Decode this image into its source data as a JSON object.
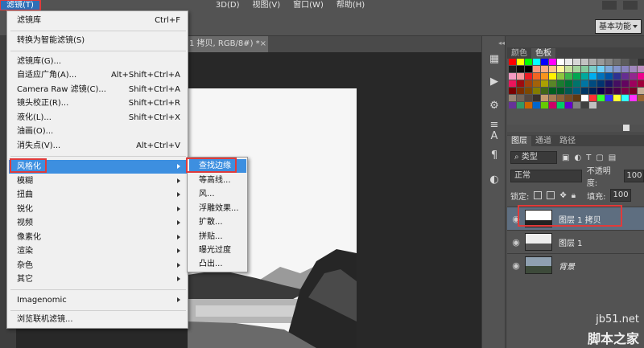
{
  "menubar": {
    "items": [
      "滤镜(T)",
      "3D(D)",
      "视图(V)",
      "窗口(W)",
      "帮助(H)"
    ]
  },
  "optbar": {
    "workspace": "基本功能"
  },
  "document": {
    "tab_title": "1 拷贝, RGB/8#) *",
    "tab_close": "×"
  },
  "filter_menu": {
    "items": [
      {
        "label": "滤镜库",
        "shortcut": "Ctrl+F"
      },
      {
        "label": "转换为智能滤镜(S)",
        "shortcut": ""
      },
      {
        "label": "滤镜库(G)...",
        "shortcut": ""
      },
      {
        "label": "自适应广角(A)...",
        "shortcut": "Alt+Shift+Ctrl+A"
      },
      {
        "label": "Camera Raw 滤镜(C)...",
        "shortcut": "Shift+Ctrl+A"
      },
      {
        "label": "镜头校正(R)...",
        "shortcut": "Shift+Ctrl+R"
      },
      {
        "label": "液化(L)...",
        "shortcut": "Shift+Ctrl+X"
      },
      {
        "label": "油画(O)...",
        "shortcut": ""
      },
      {
        "label": "消失点(V)...",
        "shortcut": "Alt+Ctrl+V"
      },
      {
        "label": "风格化",
        "shortcut": ""
      },
      {
        "label": "模糊",
        "shortcut": ""
      },
      {
        "label": "扭曲",
        "shortcut": ""
      },
      {
        "label": "锐化",
        "shortcut": ""
      },
      {
        "label": "视频",
        "shortcut": ""
      },
      {
        "label": "像素化",
        "shortcut": ""
      },
      {
        "label": "渲染",
        "shortcut": ""
      },
      {
        "label": "杂色",
        "shortcut": ""
      },
      {
        "label": "其它",
        "shortcut": ""
      },
      {
        "label": "Imagenomic",
        "shortcut": ""
      },
      {
        "label": "浏览联机滤镜...",
        "shortcut": ""
      }
    ]
  },
  "stylize_submenu": {
    "items": [
      "查找边缘",
      "等高线...",
      "风...",
      "浮雕效果...",
      "扩散...",
      "拼贴...",
      "曝光过度",
      "凸出..."
    ]
  },
  "swatches_panel": {
    "tabs": [
      "颜色",
      "色板"
    ],
    "colors": [
      "#ff0000",
      "#ffff00",
      "#00ff00",
      "#00ffff",
      "#0000ff",
      "#ff00ff",
      "#ffffff",
      "#ebebeb",
      "#d6d6d6",
      "#c2c2c2",
      "#adadad",
      "#999999",
      "#858585",
      "#707070",
      "#5c5c5c",
      "#474747",
      "#333333",
      "#1f1f1f",
      "#0a0a0a",
      "#000000",
      "#f7977a",
      "#f9ad81",
      "#fdc68a",
      "#fff79a",
      "#c4df9b",
      "#a3d39c",
      "#82ca9d",
      "#7bcdc8",
      "#6ecff6",
      "#7ea7d8",
      "#8493ca",
      "#8882be",
      "#a187be",
      "#bc8dbf",
      "#f49ac2",
      "#f6989d",
      "#ed1c24",
      "#f26522",
      "#f7941d",
      "#fff200",
      "#8dc63f",
      "#39b54a",
      "#00a651",
      "#00a99d",
      "#00aeef",
      "#0072bc",
      "#0054a6",
      "#2e3192",
      "#662d91",
      "#92278f",
      "#ec008c",
      "#ed145b",
      "#9e0b0f",
      "#a0410d",
      "#a36209",
      "#aba000",
      "#598527",
      "#1a7b30",
      "#007236",
      "#00746b",
      "#0076a3",
      "#004b80",
      "#003471",
      "#1b1464",
      "#440e62",
      "#630460",
      "#9e005d",
      "#9e0039",
      "#790000",
      "#7b2e00",
      "#7d4900",
      "#827b00",
      "#406618",
      "#005e20",
      "#005826",
      "#005952",
      "#005b7f",
      "#003663",
      "#002157",
      "#0d004c",
      "#32004b",
      "#4b0049",
      "#7b0046",
      "#7a0026",
      "#c7b299",
      "#998675",
      "#736357",
      "#534741",
      "#37302d",
      "#c69c6d",
      "#a67c52",
      "#8c6239",
      "#754c24",
      "#603913",
      "#ffffff",
      "#ff3333",
      "#33ff33",
      "#3333ff",
      "#ffff33",
      "#33ffff",
      "#ff33ff",
      "#996633",
      "#663399",
      "#339966",
      "#cc6600",
      "#0066cc",
      "#66cc00",
      "#cc0066",
      "#00cc66",
      "#6600cc",
      "#808080",
      "#404040",
      "#c0c0c0"
    ]
  },
  "layers_panel": {
    "tabs": [
      "图层",
      "通道",
      "路径"
    ],
    "filter_kind": "类型",
    "blend_mode": "正常",
    "opacity_label": "不透明度:",
    "opacity_value": "100",
    "lock_label": "锁定:",
    "fill_label": "填充:",
    "fill_value": "100",
    "layers": [
      {
        "name": "图层 1 拷贝",
        "selected": true,
        "italic": false
      },
      {
        "name": "图层 1",
        "selected": false,
        "italic": false
      },
      {
        "name": "背景",
        "selected": false,
        "italic": true
      }
    ]
  },
  "watermark": {
    "line1": "jb51.net",
    "line2": "脚本之家"
  }
}
